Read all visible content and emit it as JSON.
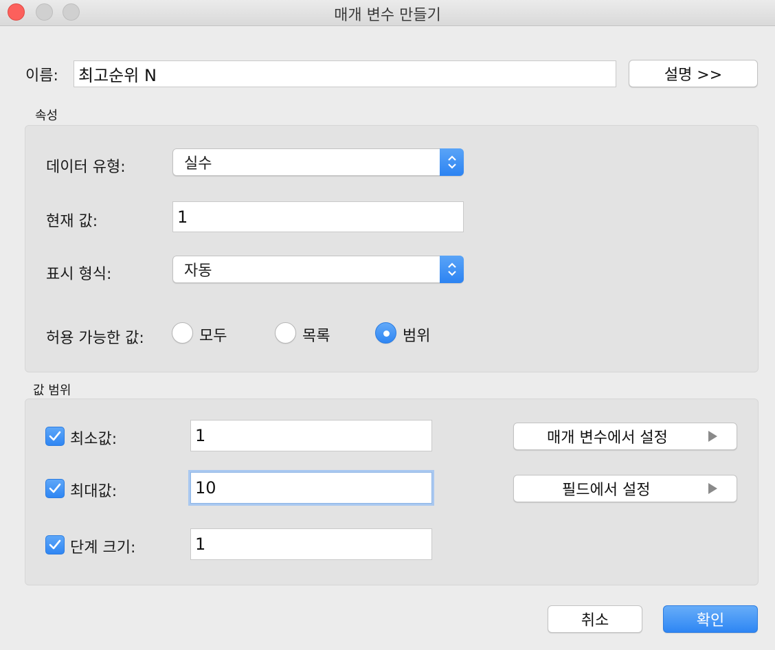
{
  "window": {
    "title": "매개 변수 만들기"
  },
  "name_row": {
    "label": "이름:",
    "value": "최고순위 N",
    "description_button": "설명 >>"
  },
  "properties": {
    "section_label": "속성",
    "data_type": {
      "label": "데이터 유형:",
      "value": "실수"
    },
    "current_value": {
      "label": "현재 값:",
      "value": "1"
    },
    "display_format": {
      "label": "표시 형식:",
      "value": "자동"
    },
    "allowable_values": {
      "label": "허용 가능한 값:",
      "options": [
        "모두",
        "목록",
        "범위"
      ],
      "selected": "범위"
    }
  },
  "range": {
    "section_label": "값 범위",
    "minimum": {
      "label": "최소값:",
      "value": "1",
      "checked": true
    },
    "maximum": {
      "label": "최대값:",
      "value": "10",
      "checked": true
    },
    "step_size": {
      "label": "단계 크기:",
      "value": "1",
      "checked": true
    },
    "set_from_parameter": "매개 변수에서 설정",
    "set_from_field": "필드에서 설정"
  },
  "footer": {
    "cancel": "취소",
    "ok": "확인"
  },
  "colors": {
    "accent": "#2f86f3",
    "close": "#fc605c"
  }
}
